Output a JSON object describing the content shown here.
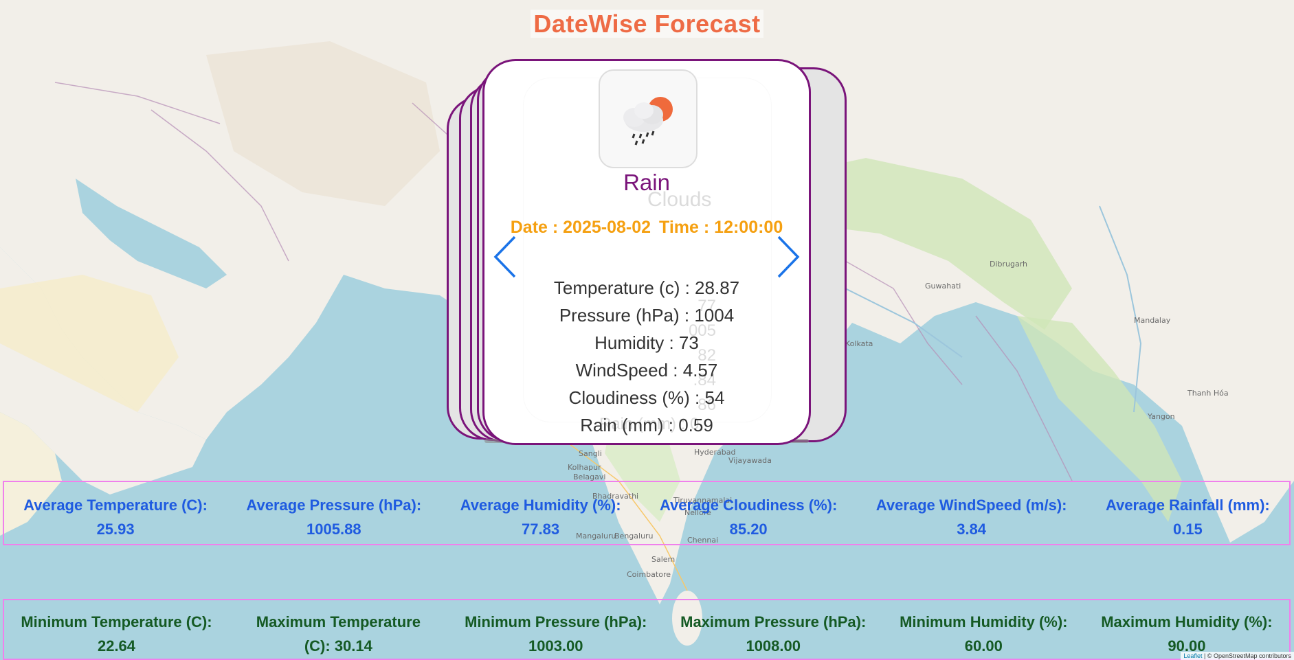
{
  "title": "DateWise Forecast",
  "card": {
    "icon": "rain-cloud-sun-icon",
    "description": "Rain",
    "date_label": "Date : 2025-08-02",
    "time_label": "Time : 12:00:00",
    "metrics": [
      "Temperature (c) : 28.87",
      "Pressure (hPa) : 1004",
      "Humidity : 73",
      "WindSpeed : 4.57",
      "Cloudiness (%) : 54",
      "Rain (mm) : 0.59"
    ],
    "ghost": {
      "description": "Clouds",
      "metrics": [
        "77",
        "005",
        "82",
        ".84",
        "86",
        "Rain (mm) : 0"
      ]
    }
  },
  "averages": [
    {
      "label": "Average Temperature (C):",
      "value": "25.93"
    },
    {
      "label": "Average Pressure (hPa):",
      "value": "1005.88"
    },
    {
      "label": "Average Humidity (%):",
      "value": "77.83"
    },
    {
      "label": "Average Cloudiness (%):",
      "value": "85.20"
    },
    {
      "label": "Average WindSpeed (m/s):",
      "value": "3.84"
    },
    {
      "label": "Average Rainfall (mm):",
      "value": "0.15"
    }
  ],
  "minmax": [
    {
      "label": "Minimum Temperature (C):",
      "value": "22.64"
    },
    {
      "label": "Maximum Temperature",
      "value": "(C): 30.14"
    },
    {
      "label": "Minimum Pressure (hPa):",
      "value": "1003.00"
    },
    {
      "label": "Maximum Pressure (hPa):",
      "value": "1008.00"
    },
    {
      "label": "Minimum Humidity (%):",
      "value": "60.00"
    },
    {
      "label": "Maximum Humidity (%):",
      "value": "90.00"
    }
  ],
  "attribution": {
    "leaflet": "Leaflet",
    "osm": "| © OpenStreetMap contributors"
  },
  "map_labels": [
    "Hyderabad",
    "Sangli",
    "Kolhapur",
    "Belagavi",
    "Vijayawada",
    "Nellore",
    "Chennai",
    "Coimbatore",
    "Salem",
    "Kolkata",
    "Guwahati",
    "Dibrugarh",
    "Mandalay",
    "Yangon",
    "Thanh Hóa",
    "Bengaluru",
    "Bhadravathi",
    "Mangaluru",
    "Tiruvannamalai"
  ],
  "colors": {
    "title": "#ee6b45",
    "card_border": "#7a147a",
    "date_time": "#f5a011",
    "average_text": "#1f5be0",
    "minmax_text": "#155a24",
    "row_border": "#f080ec",
    "nav_arrow": "#1a73e8"
  }
}
